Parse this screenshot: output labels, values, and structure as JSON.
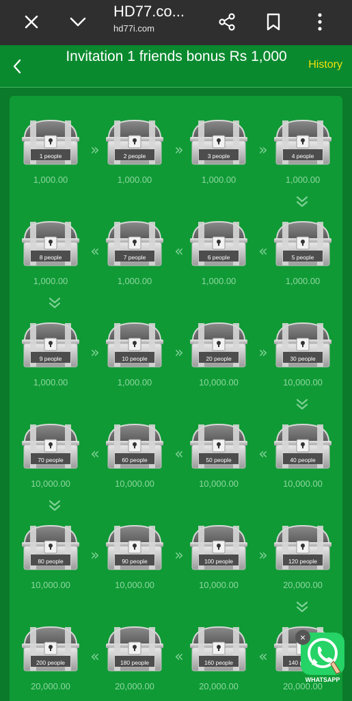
{
  "browser": {
    "title": "HD77.co...",
    "url": "hd77i.com",
    "icons": [
      "close-icon",
      "chevron-down-icon",
      "share-icon",
      "bookmark-icon",
      "more-vert-icon"
    ]
  },
  "header": {
    "title": "Invitation 1 friends bonus Rs 1,000",
    "history": "History"
  },
  "rows": [
    {
      "dir": "ltr",
      "items": [
        {
          "label": "1 people",
          "amount": "1,000.00"
        },
        {
          "label": "2 people",
          "amount": "1,000.00"
        },
        {
          "label": "3 people",
          "amount": "1,000.00"
        },
        {
          "label": "4 people",
          "amount": "1,000.00"
        }
      ]
    },
    {
      "dir": "rtl",
      "items": [
        {
          "label": "8 people",
          "amount": "1,000.00"
        },
        {
          "label": "7 people",
          "amount": "1,000.00"
        },
        {
          "label": "6 people",
          "amount": "1,000.00"
        },
        {
          "label": "5 people",
          "amount": "1,000.00"
        }
      ]
    },
    {
      "dir": "ltr",
      "items": [
        {
          "label": "9 people",
          "amount": "1,000.00"
        },
        {
          "label": "10 people",
          "amount": "1,000.00"
        },
        {
          "label": "20 people",
          "amount": "10,000.00"
        },
        {
          "label": "30 people",
          "amount": "10,000.00"
        }
      ]
    },
    {
      "dir": "rtl",
      "items": [
        {
          "label": "70 people",
          "amount": "10,000.00"
        },
        {
          "label": "60 people",
          "amount": "10,000.00"
        },
        {
          "label": "50 people",
          "amount": "10,000.00"
        },
        {
          "label": "40 people",
          "amount": "10,000.00"
        }
      ]
    },
    {
      "dir": "ltr",
      "items": [
        {
          "label": "80 people",
          "amount": "10,000.00"
        },
        {
          "label": "90 people",
          "amount": "10,000.00"
        },
        {
          "label": "100 people",
          "amount": "10,000.00"
        },
        {
          "label": "120 people",
          "amount": "20,000.00"
        }
      ]
    },
    {
      "dir": "rtl",
      "items": [
        {
          "label": "200 people",
          "amount": "20,000.00"
        },
        {
          "label": "180 people",
          "amount": "20,000.00"
        },
        {
          "label": "160 people",
          "amount": "20,000.00"
        },
        {
          "label": "140 people",
          "amount": "20,000.00"
        }
      ]
    }
  ],
  "whatsapp": {
    "label": "WHATSAPP",
    "close": "×"
  },
  "colors": {
    "accent": "#f5e10a",
    "green": "#0f9a35",
    "amount": "#8fd7a1"
  }
}
